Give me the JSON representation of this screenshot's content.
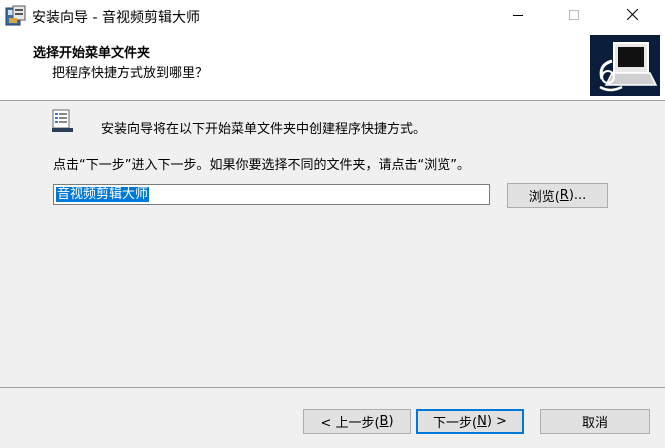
{
  "window": {
    "title": "安装向导 - 音视频剪辑大师",
    "icon": "installer-icon",
    "controls": [
      "minimize-icon",
      "maximize-icon",
      "close-icon"
    ]
  },
  "header": {
    "title": "选择开始菜单文件夹",
    "subtitle": "把程序快捷方式放到哪里？",
    "image": "computer-installer-image"
  },
  "body": {
    "info_text": "安装向导将在以下开始菜单文件夹中创建程序快捷方式。",
    "hint_text": "点击“下一步”进入下一步。如果你要选择不同的文件夹，请点击“浏览”。",
    "folder_value": "音视频剪辑大师",
    "browse_label_pre": "浏览(",
    "browse_key": "R",
    "browse_label_post": ")..."
  },
  "footer": {
    "back_label_pre": "< 上一步(",
    "back_key": "B",
    "back_label_post": ")",
    "next_label_pre": "下一步(",
    "next_key": "N",
    "next_label_post": ") >",
    "cancel_label": "取消"
  },
  "colors": {
    "selection": "#0078d7",
    "header_bg": "#ffffff",
    "dialog_bg": "#f0f0f0"
  }
}
